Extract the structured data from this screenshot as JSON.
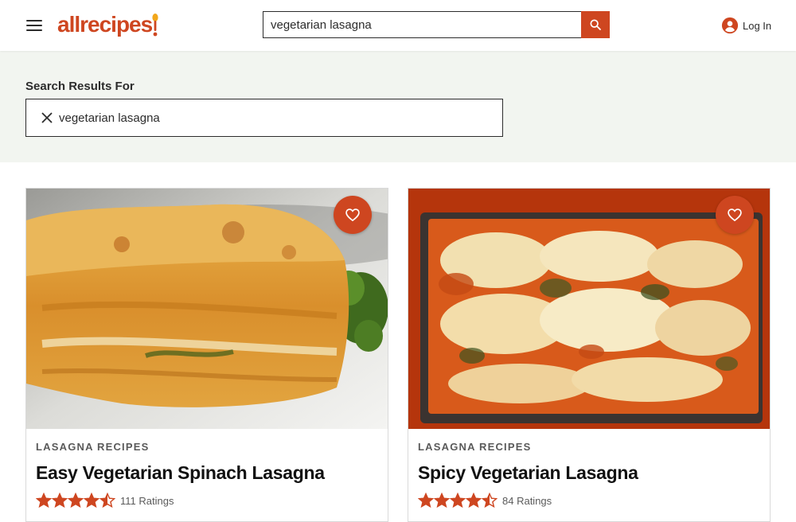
{
  "header": {
    "logo_text": "allrecipes",
    "search_value": "vegetarian lasagna",
    "login_label": "Log In"
  },
  "results": {
    "label": "Search Results For",
    "query": "vegetarian lasagna"
  },
  "cards": [
    {
      "category": "LASAGNA RECIPES",
      "title": "Easy Vegetarian Spinach Lasagna",
      "rating": 4.5,
      "ratings_text": "111 Ratings"
    },
    {
      "category": "LASAGNA RECIPES",
      "title": "Spicy Vegetarian Lasagna",
      "rating": 4.5,
      "ratings_text": "84 Ratings"
    }
  ],
  "colors": {
    "brand": "#ce4620",
    "band": "#f2f5f0"
  }
}
